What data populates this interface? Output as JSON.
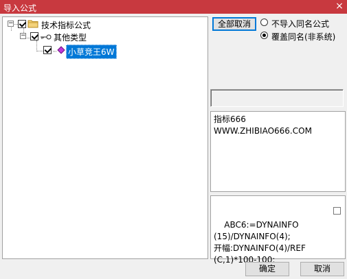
{
  "window": {
    "title": "导入公式",
    "close_glyph": "×"
  },
  "tree": {
    "root": {
      "label": "技术指标公式",
      "expander": "−",
      "checked": true
    },
    "category": {
      "label": "其他类型",
      "expander": "−",
      "checked": true
    },
    "formula": {
      "label": "小草竞王6W",
      "checked": true
    }
  },
  "controls": {
    "cancel_all_label": "全部取消",
    "radio_no_import_label": "不导入同名公式",
    "radio_overwrite_label": "覆盖同名(非系统)",
    "selected_option": "覆盖同名(非系统)"
  },
  "description": {
    "text": "指标666\nWWW.ZHIBIAO666.COM"
  },
  "source": {
    "text": "ABC6:=DYNAINFO\n(15)/DYNAINFO(4);\n开幅:DYNAINFO(4)/REF\n(C,1)*100-100;"
  },
  "footer": {
    "ok_label": "确定",
    "cancel_label": "取消"
  },
  "colors": {
    "titlebar": "#c8393f",
    "selection": "#0078d7"
  },
  "icons": {
    "root": "folder-icon",
    "category": "key-icon",
    "formula": "diamond-icon"
  }
}
